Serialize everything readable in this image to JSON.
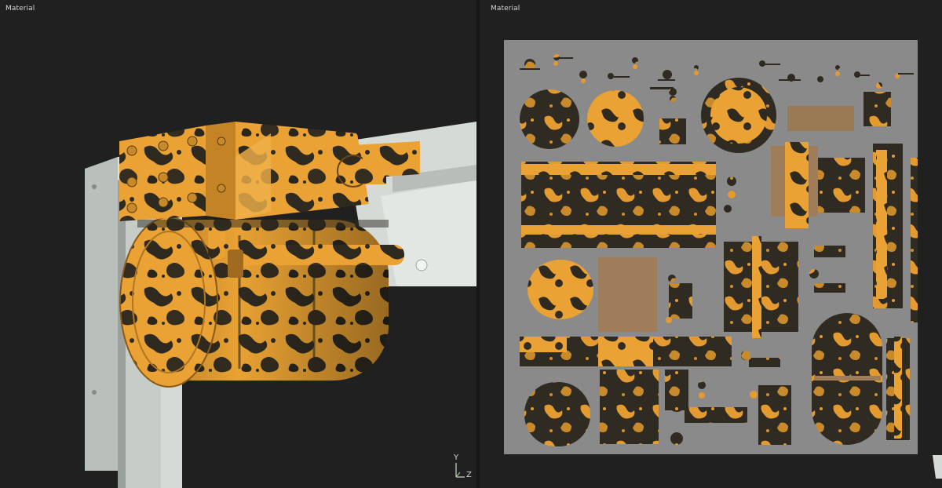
{
  "left_viewport": {
    "label": "Material",
    "axis_gizmo": {
      "y_label": "Y",
      "z_label": "Z"
    }
  },
  "right_viewport": {
    "label": "Material"
  },
  "colors": {
    "background": "#202020",
    "divider": "#151515",
    "paint_yellow": "#e9a233",
    "rust_dark": "#2e2a20",
    "uv_background": "#8a8a8a",
    "frame_gray": "#c9cecb",
    "bare_metal": "#a07d5a"
  },
  "icons": [
    "axis-gizmo-icon"
  ]
}
